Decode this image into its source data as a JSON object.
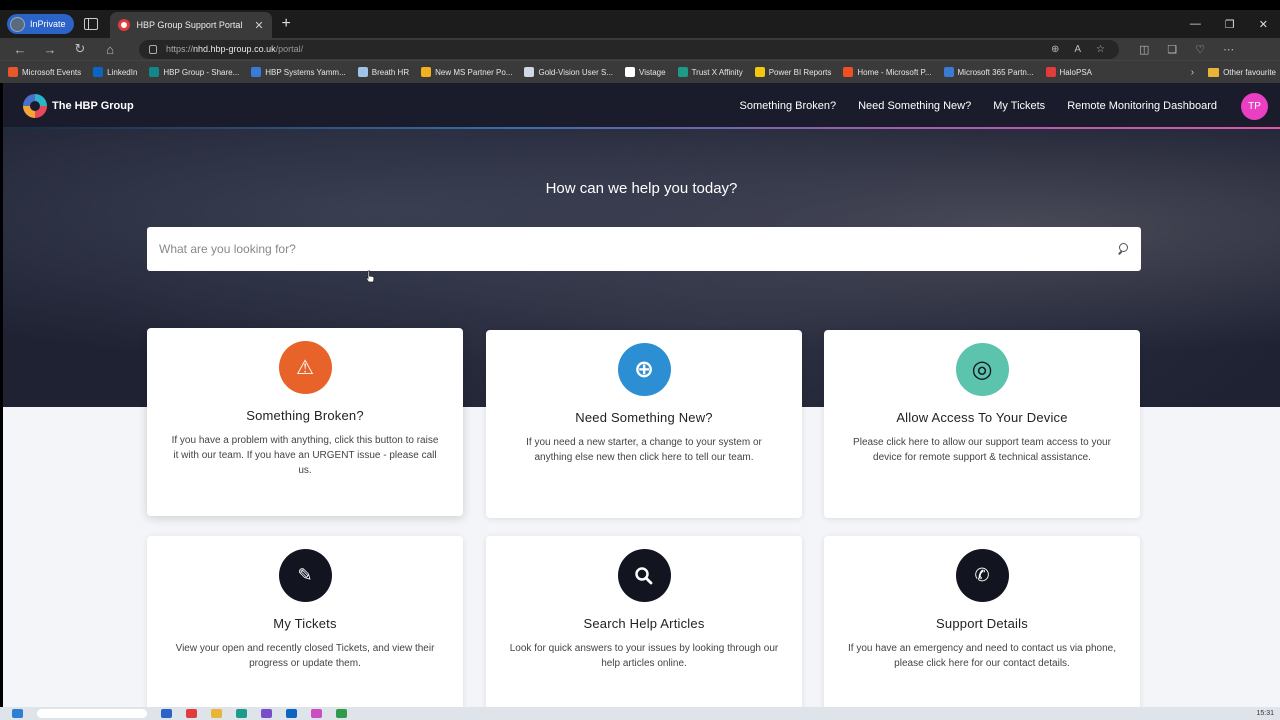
{
  "browser": {
    "inprivate_label": "InPrivate",
    "tab_title": "HBP Group Support Portal",
    "tab_close": "✕",
    "new_tab": "+",
    "url_scheme": "https://",
    "url_host": "nhd.hbp-group.co.uk",
    "url_path": "/portal/",
    "bookmarks": [
      {
        "label": "Microsoft Events",
        "color": "#e8572a"
      },
      {
        "label": "LinkedIn",
        "color": "#0a66c2"
      },
      {
        "label": "HBP Group - Share...",
        "color": "#13878b"
      },
      {
        "label": "HBP Systems Yamm...",
        "color": "#3a7bd5"
      },
      {
        "label": "Breath HR",
        "color": "#9fc3e8"
      },
      {
        "label": "New MS Partner Po...",
        "color": "#f2b01e"
      },
      {
        "label": "Gold-Vision User S...",
        "color": "#cfd8e3"
      },
      {
        "label": "Vistage",
        "color": "#ffffff"
      },
      {
        "label": "Trust X Affinity",
        "color": "#1d9b8a"
      },
      {
        "label": "Power BI Reports",
        "color": "#f2c811"
      },
      {
        "label": "Home - Microsoft P...",
        "color": "#f25022"
      },
      {
        "label": "Microsoft 365 Partn...",
        "color": "#3a7bd5"
      },
      {
        "label": "HaloPSA",
        "color": "#e23b3b"
      }
    ],
    "other_favourites": "Other favourite"
  },
  "site": {
    "brand": "The HBP Group",
    "nav": [
      "Something Broken?",
      "Need Something New?",
      "My Tickets",
      "Remote Monitoring Dashboard"
    ],
    "avatar_initials": "TP",
    "hero_title": "How can we help you today?",
    "search_placeholder": "What are you looking for?",
    "cards": [
      {
        "title": "Something Broken?",
        "text": "If you have a problem with anything, click this button to raise it with our team. If you have an URGENT issue - please call us.",
        "icon": "warning-icon",
        "glyph": "⚠",
        "color": "#e8632a"
      },
      {
        "title": "Need Something New?",
        "text": "If you need a new starter, a change to your system or anything else new then click here to tell our team.",
        "icon": "plus-circle-icon",
        "glyph": "+",
        "color": "#2d8fd3"
      },
      {
        "title": "Allow Access To Your Device",
        "text": "Please click here to allow our support team access to your device for remote support & technical assistance.",
        "icon": "lifebuoy-icon",
        "glyph": "◎",
        "color": "#5cc3ad"
      },
      {
        "title": "My Tickets",
        "text": "View your open and recently closed Tickets, and view their progress or update them.",
        "icon": "ticket-icon",
        "glyph": "✎",
        "color": "#12141f"
      },
      {
        "title": "Search Help Articles",
        "text": "Look for quick answers to your issues by looking through our help articles online.",
        "icon": "search-icon",
        "glyph": "⌕",
        "color": "#12141f"
      },
      {
        "title": "Support Details",
        "text": "If you have an emergency and need to contact us via phone, please click here for our contact details.",
        "icon": "phone-icon",
        "glyph": "✆",
        "color": "#12141f"
      }
    ]
  },
  "taskbar": {
    "clock": "15:31"
  }
}
